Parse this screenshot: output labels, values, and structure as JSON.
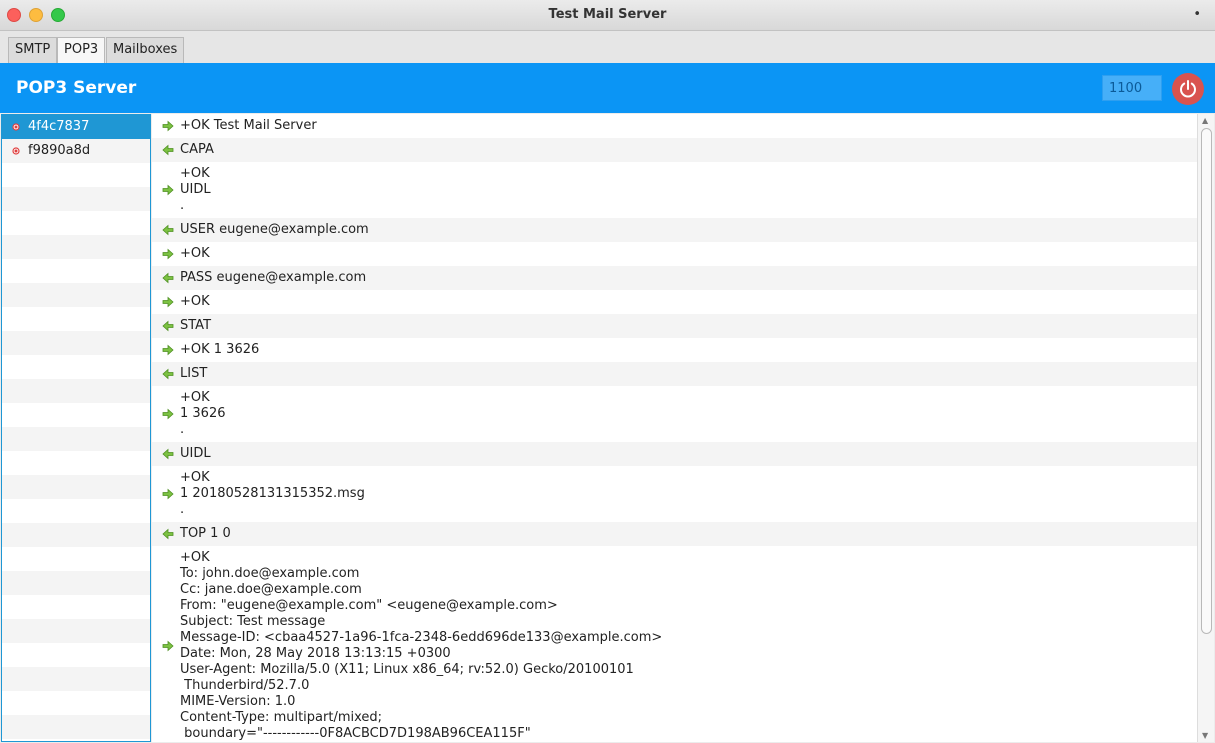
{
  "window": {
    "title": "Test Mail Server",
    "status_dot": "•"
  },
  "tabs": [
    {
      "label": "SMTP"
    },
    {
      "label": "POP3"
    },
    {
      "label": "Mailboxes"
    }
  ],
  "header": {
    "title": "POP3 Server",
    "port_value": "1100",
    "accent_color": "#0b95f5",
    "power_color": "#d9534f"
  },
  "sessions": [
    {
      "id": "4f4c7837",
      "selected": true
    },
    {
      "id": "f9890a8d",
      "selected": false
    }
  ],
  "log": [
    {
      "direction": "out",
      "text": "+OK Test Mail Server"
    },
    {
      "direction": "in",
      "text": "CAPA"
    },
    {
      "direction": "out",
      "text": "+OK\nUIDL\n."
    },
    {
      "direction": "in",
      "text": "USER eugene@example.com"
    },
    {
      "direction": "out",
      "text": "+OK"
    },
    {
      "direction": "in",
      "text": "PASS eugene@example.com"
    },
    {
      "direction": "out",
      "text": "+OK"
    },
    {
      "direction": "in",
      "text": "STAT"
    },
    {
      "direction": "out",
      "text": "+OK 1 3626"
    },
    {
      "direction": "in",
      "text": "LIST"
    },
    {
      "direction": "out",
      "text": "+OK\n1 3626\n."
    },
    {
      "direction": "in",
      "text": "UIDL"
    },
    {
      "direction": "out",
      "text": "+OK\n1 20180528131315352.msg\n."
    },
    {
      "direction": "in",
      "text": "TOP 1 0"
    },
    {
      "direction": "out",
      "text": "+OK\nTo: john.doe@example.com\nCc: jane.doe@example.com\nFrom: \"eugene@example.com\" <eugene@example.com>\nSubject: Test message\nMessage-ID: <cbaa4527-1a96-1fca-2348-6edd696de133@example.com>\nDate: Mon, 28 May 2018 13:13:15 +0300\nUser-Agent: Mozilla/5.0 (X11; Linux x86_64; rv:52.0) Gecko/20100101\n Thunderbird/52.7.0\nMIME-Version: 1.0\nContent-Type: multipart/mixed;\n boundary=\"------------0F8ACBCD7D198AB96CEA115F\""
    }
  ]
}
